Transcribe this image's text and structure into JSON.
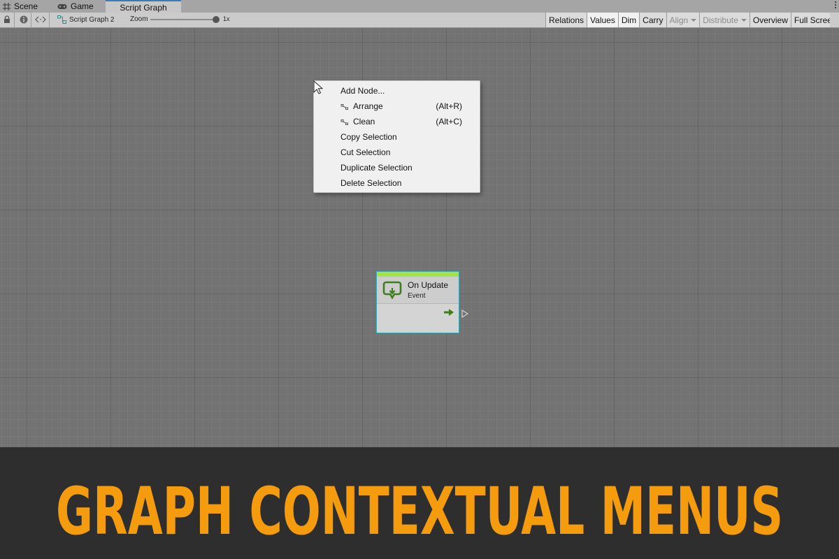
{
  "tabs": [
    {
      "label": "Scene",
      "icon": "grid-icon"
    },
    {
      "label": "Game",
      "icon": "gamepad-icon"
    },
    {
      "label": "Script Graph",
      "active": true
    }
  ],
  "toolbar": {
    "breadcrumb": "Script Graph 2",
    "zoom_label": "Zoom",
    "zoom_value": "1x",
    "zoom_level": 1.0,
    "buttons": [
      {
        "label": "Relations",
        "state": "normal"
      },
      {
        "label": "Values",
        "state": "on"
      },
      {
        "label": "Dim",
        "state": "on"
      },
      {
        "label": "Carry",
        "state": "normal"
      },
      {
        "label": "Align",
        "state": "disabled",
        "dropdown": true
      },
      {
        "label": "Distribute",
        "state": "disabled",
        "dropdown": true
      },
      {
        "label": "Overview",
        "state": "normal"
      },
      {
        "label": "Full Screen",
        "state": "normal"
      }
    ]
  },
  "context_menu": {
    "items": [
      {
        "label": "Add Node...",
        "shortcut": ""
      },
      {
        "label": "Arrange",
        "shortcut": "(Alt+R)",
        "icon": "arrange-icon"
      },
      {
        "label": "Clean",
        "shortcut": "(Alt+C)",
        "icon": "clean-icon"
      },
      {
        "label": "Copy Selection",
        "shortcut": ""
      },
      {
        "label": "Cut Selection",
        "shortcut": ""
      },
      {
        "label": "Duplicate Selection",
        "shortcut": ""
      },
      {
        "label": "Delete Selection",
        "shortcut": ""
      }
    ]
  },
  "node": {
    "title": "On Update",
    "subtitle": "Event",
    "header_color": "#a6e34b",
    "border_color": "#39a9b4",
    "icon": "update-loop-icon",
    "flow_color": "#3e7d1c"
  },
  "banner": {
    "text": "GRAPH CONTEXTUAL MENUS",
    "color": "#f59c0e"
  },
  "colors": {
    "canvas": "#737373",
    "toolbar": "#cbcbcb",
    "menu_background": "#f0f0f0",
    "active_tab_accent": "#3a79bb"
  }
}
